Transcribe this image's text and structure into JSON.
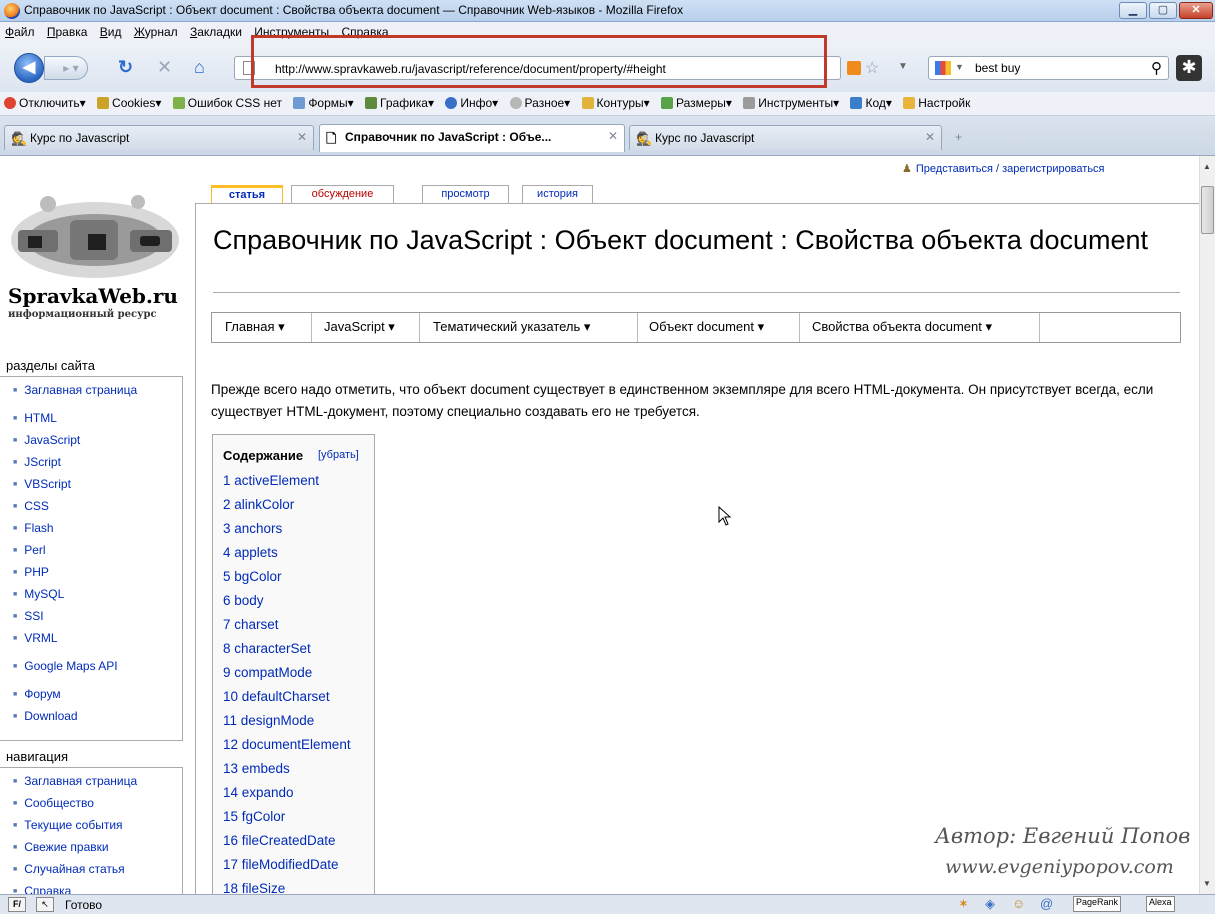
{
  "window": {
    "title": "Справочник по JavaScript : Объект document : Свойства объекта document — Справочник Web-языков - Mozilla Firefox"
  },
  "menu": [
    "Файл",
    "Правка",
    "Вид",
    "Журнал",
    "Закладки",
    "Инструменты",
    "Справка"
  ],
  "nav": {
    "url": "http://www.spravkaweb.ru/javascript/reference/document/property/#height",
    "search_value": "best buy"
  },
  "devbar": [
    "Отключить",
    "Cookies",
    "Ошибок CSS нет",
    "Формы",
    "Графика",
    "Инфо",
    "Разное",
    "Контуры",
    "Размеры",
    "Инструменты",
    "Код",
    "Настройк"
  ],
  "tabs": [
    {
      "label": "Курс по Javascript",
      "active": false
    },
    {
      "label": "Справочник по JavaScript : Объе...",
      "active": true
    },
    {
      "label": "Курс по Javascript",
      "active": false
    }
  ],
  "page": {
    "login": "Представиться / зарегистрироваться",
    "logo_name": "SpravkaWeb.ru",
    "logo_sub": "информационный ресурс",
    "content_tabs": [
      "статья",
      "обсуждение",
      "просмотр",
      "история"
    ],
    "heading": "Справочник по JavaScript : Объект document : Свойства объекта document",
    "breadcrumbs": [
      "Главная ▾",
      "JavaScript ▾",
      "Тематический указатель ▾",
      "Объект document ▾",
      "Свойства объекта document ▾"
    ],
    "intro": "Прежде всего надо отметить, что объект document существует в единственном экземпляре для всего HTML-документа. Он присутствует всегда, если существует HTML-документ, поэтому специально создавать его не требуется.",
    "toc": {
      "title": "Содержание",
      "hide": "[убрать]",
      "items": [
        "1 activeElement",
        "2 alinkColor",
        "3 anchors",
        "4 applets",
        "5 bgColor",
        "6 body",
        "7 charset",
        "8 characterSet",
        "9 compatMode",
        "10 defaultCharset",
        "11 designMode",
        "12 documentElement",
        "13 embeds",
        "14 expando",
        "15 fgColor",
        "16 fileCreatedDate",
        "17 fileModifiedDate",
        "18 fileSize"
      ]
    },
    "sidebar": {
      "sections_title": "разделы сайта",
      "sections": [
        "Заглавная страница",
        "HTML",
        "JavaScript",
        "JScript",
        "VBScript",
        "CSS",
        "Flash",
        "Perl",
        "PHP",
        "MySQL",
        "SSI",
        "VRML",
        "Google Maps API",
        "Форум",
        "Download"
      ],
      "nav_title": "навигация",
      "nav": [
        "Заглавная страница",
        "Сообщество",
        "Текущие события",
        "Свежие правки",
        "Случайная статья",
        "Справка"
      ]
    },
    "watermark": [
      "Автор: Евгений Попов",
      "www.evgeniypopov.com"
    ]
  },
  "status": {
    "text": "Готово",
    "pagerank": "PageRank",
    "alexa": "Alexa"
  },
  "colors": {
    "link": "#002bb8",
    "highlight_box": "#c0392b",
    "selected_tab_accent": "#fabd23"
  }
}
